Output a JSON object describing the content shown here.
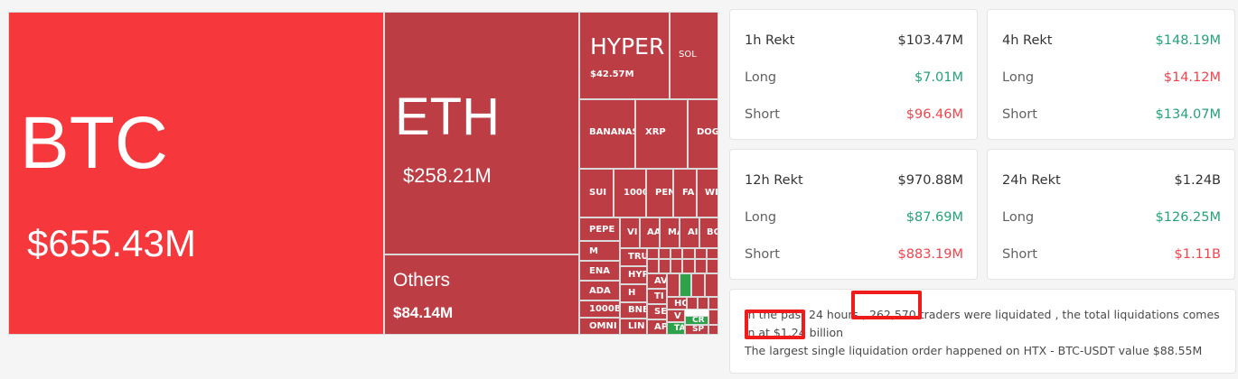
{
  "treemap": {
    "btc": {
      "symbol": "BTC",
      "value": "$655.43M"
    },
    "eth": {
      "symbol": "ETH",
      "value": "$258.21M"
    },
    "others": {
      "symbol": "Others",
      "value": "$84.14M"
    },
    "hyper": {
      "symbol": "HYPER",
      "value": "$42.57M"
    },
    "sol": "SOL",
    "bananas": "BANANAS",
    "xrp": "XRP",
    "doge": "DOGE",
    "sui": "SUI",
    "t1000": "1000",
    "pen": "PEN",
    "fa": "FA",
    "wi": "WI",
    "pepe": "PEPE",
    "m": "M",
    "ena": "ENA",
    "ada": "ADA",
    "t1000b": "1000B",
    "omni": "OMNI",
    "vi": "VI",
    "aa": "AA",
    "ma": "MA",
    "ai": "AI",
    "bo": "BO",
    "tru": "TRU",
    "hyp": "HYP",
    "av": "AV",
    "h": "H",
    "ti": "TI",
    "bnb": "BNB",
    "se": "SE",
    "ho": "HO",
    "lin": "LIN",
    "v": "V",
    "ap": "AP",
    "cr": "CR",
    "ta": "TA",
    "sp": "SP"
  },
  "cards": [
    {
      "title": "1h Rekt",
      "total": "$103.47M",
      "long_label": "Long",
      "long": "$7.01M",
      "short_label": "Short",
      "short": "$96.46M"
    },
    {
      "title": "4h Rekt",
      "total": "$148.19M",
      "long_label": "Long",
      "long": "$14.12M",
      "short_label": "Short",
      "short": "$134.07M"
    },
    {
      "title": "12h Rekt",
      "total": "$970.88M",
      "long_label": "Long",
      "long": "$87.69M",
      "short_label": "Short",
      "short": "$883.19M"
    },
    {
      "title": "24h Rekt",
      "total": "$1.24B",
      "long_label": "Long",
      "long": "$126.25M",
      "short_label": "Short",
      "short": "$1.11B"
    }
  ],
  "summary": {
    "p1": "In the past 24 hours ,",
    "traders": "262,570",
    "p2": "traders were liquidated , the total liquidations comes in at",
    "total": "$1.24 billion",
    "line2": "The largest single liquidation order happened on HTX - BTC-USDT value $88.55M"
  },
  "colors": {
    "green": "#26a17b",
    "red": "#f0444d",
    "tile_dark": "#bd3d44",
    "tile_bright": "#f6383d",
    "highlight": "#ef1c1c"
  }
}
